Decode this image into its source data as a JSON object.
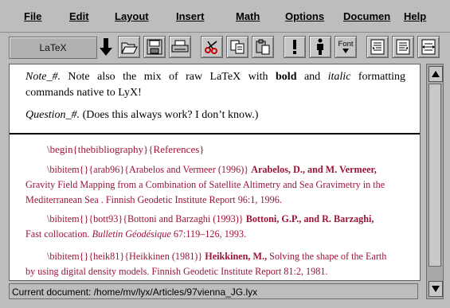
{
  "menu": [
    "File",
    "Edit",
    "Layout",
    "Insert",
    "Math",
    "Options",
    "Documen",
    "Help"
  ],
  "toolbar": {
    "layout_value": "LaTeX",
    "font_label": "Font"
  },
  "doc": {
    "note_prefix": "Note_#.",
    "note_text_1": " Note also the mix of raw LaTeX with ",
    "note_bold": "bold",
    "note_and": " and ",
    "note_italic": "italic",
    "note_text_2": " formatting",
    "note_line2": "commands native to LyX!",
    "question_prefix": "Question_#.",
    "question_text": " (Does this always work? I don’t know.)",
    "begin_bib": "\\begin{thebibliography}{References}",
    "bib1_a": "\\bibitem{}{arab96}{Arabelos and Vermeer (1996)} ",
    "bib1_bold": "Arabelos, D., and M. Vermeer,",
    "bib1_line2": "Gravity Field Mapping from a Combination of Satellite Altimetry and Sea Gravimetry in the",
    "bib1_line3": "Mediterranean Sea . Finnish Geodetic Institute Report 96:1, 1996.",
    "bib2_a": "\\bibitem{}{bott93}{Bottoni and Barzaghi (1993)} ",
    "bib2_bold": "Bottoni, G.P., and R. Barzaghi,",
    "bib2_line2_a": "Fast collocation. ",
    "bib2_line2_italic": "Bulletin Géodésique",
    "bib2_line2_b": " 67:119–126, 1993.",
    "bib3_a": "\\bibitem{}{heik81}{Heikkinen (1981)} ",
    "bib3_bold": "Heikkinen, M.,",
    "bib3_tail": " Solving the shape of the Earth",
    "bib3_line2": "by using digital density models. Finnish Geodetic Institute Report 81:2, 1981."
  },
  "status": "Current document: /home/mv/lyx/Articles/97vienna_JG.lyx"
}
